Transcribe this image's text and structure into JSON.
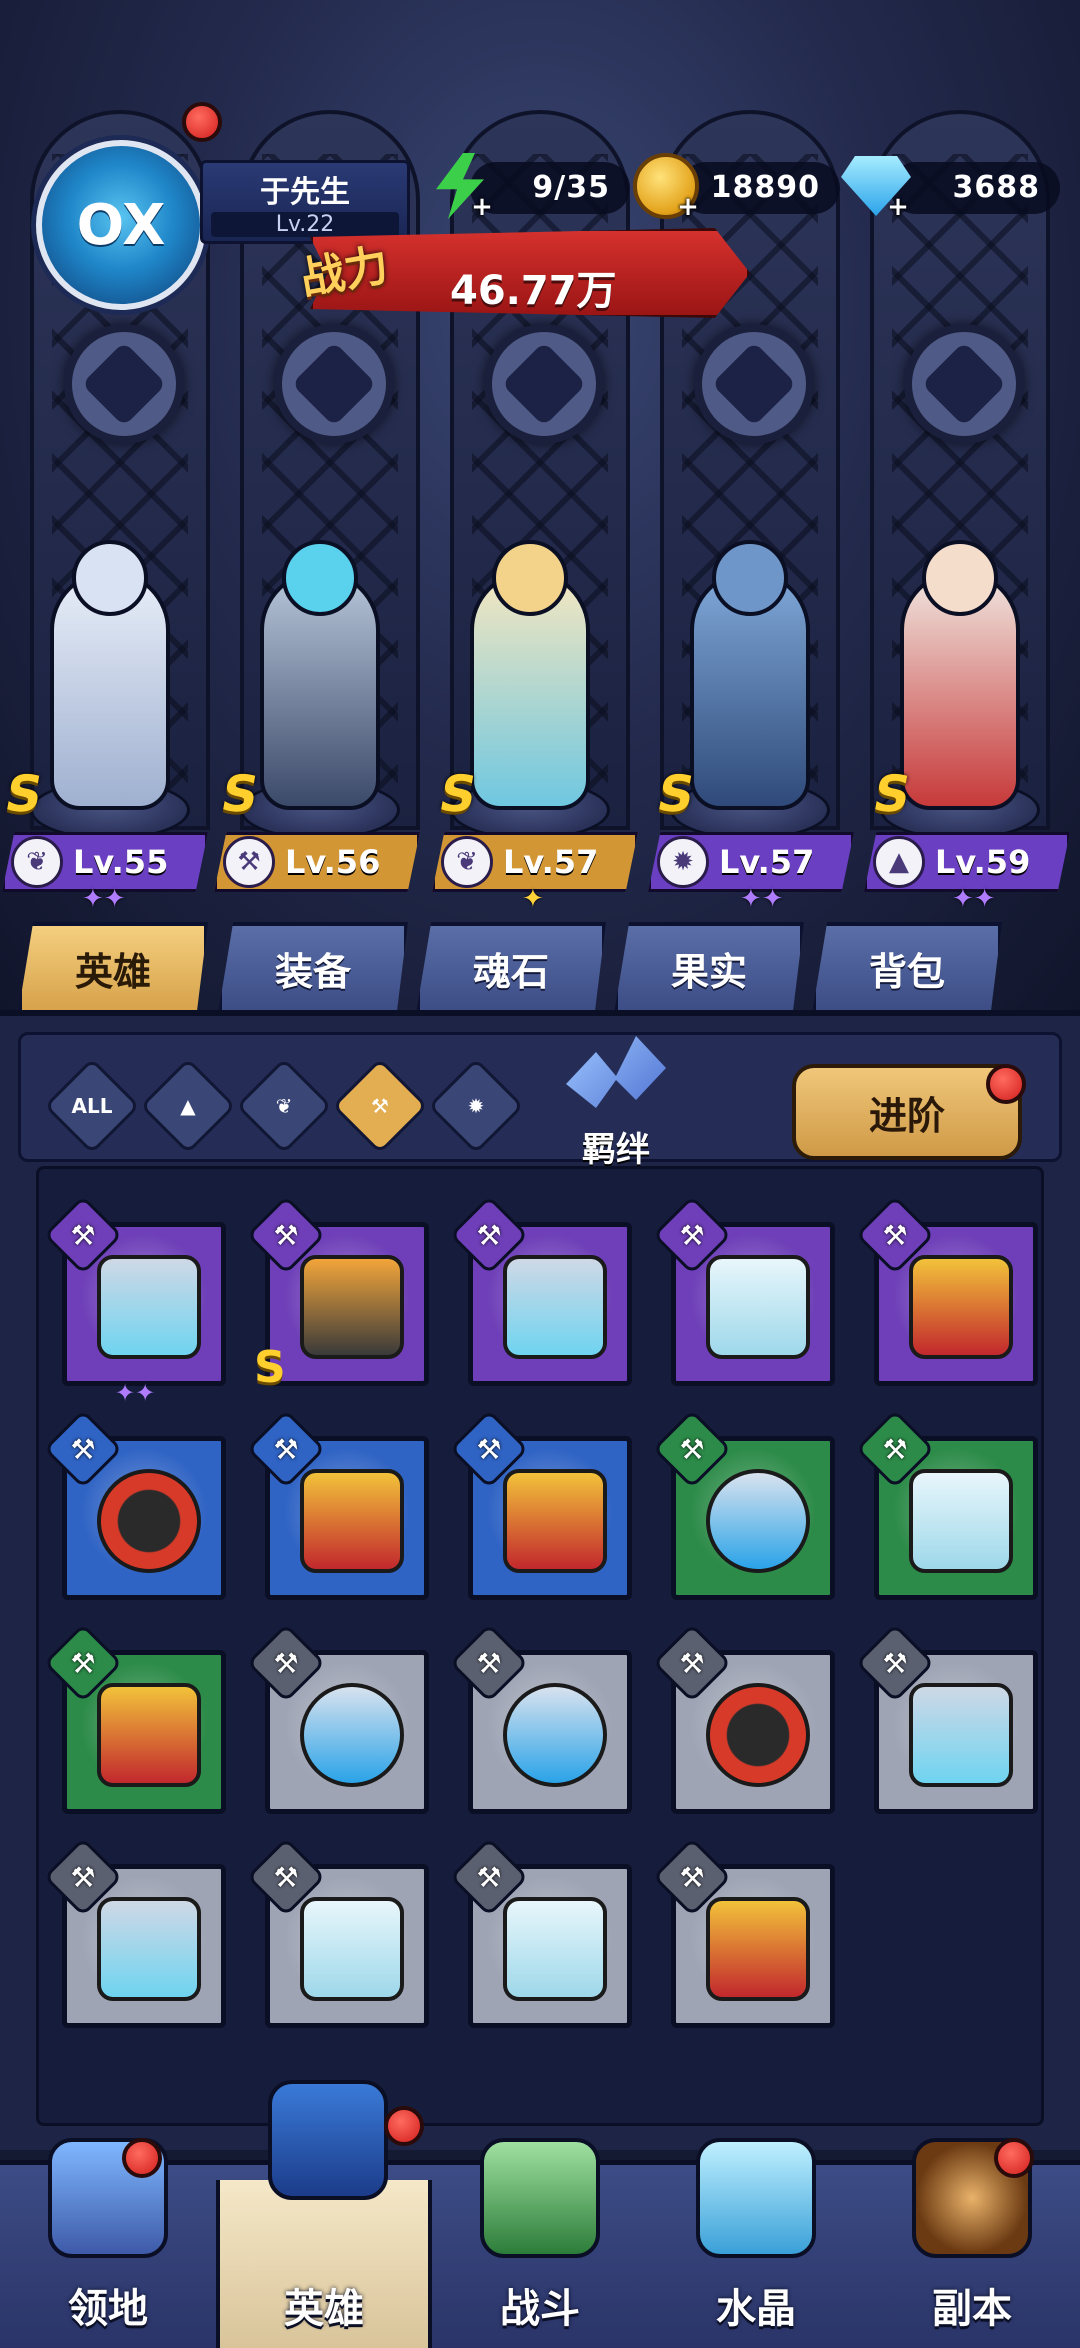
{
  "player": {
    "name": "于先生",
    "level": "Lv.22",
    "avatar_glyph": "OX"
  },
  "resources": {
    "stamina": "9/35",
    "gold": "18890",
    "gems": "3688",
    "plus": "+"
  },
  "power": {
    "label": "战力",
    "value": "46.77万"
  },
  "heroes": [
    {
      "rank": "S",
      "level": "Lv.55",
      "class_icon": "wing-icon",
      "stars": "✦✦",
      "bar_color": "#6a3fc2"
    },
    {
      "rank": "S",
      "level": "Lv.56",
      "class_icon": "wrench-icon",
      "stars": "",
      "bar_color": "#d29634"
    },
    {
      "rank": "S",
      "level": "Lv.57",
      "class_icon": "wing-icon",
      "stars": "✦",
      "bar_color": "#d29634"
    },
    {
      "rank": "S",
      "level": "Lv.57",
      "class_icon": "beast-icon",
      "stars": "✦✦",
      "bar_color": "#6a3fc2"
    },
    {
      "rank": "S",
      "level": "Lv.59",
      "class_icon": "mage-icon",
      "stars": "✦✦",
      "bar_color": "#6a3fc2"
    }
  ],
  "tabs": [
    "英雄",
    "装备",
    "魂石",
    "果实",
    "背包"
  ],
  "filters": {
    "all": "ALL"
  },
  "bond_label": "羁绊",
  "advance_label": "进阶",
  "items": [
    {
      "rarity": "purple",
      "kind": "frame",
      "stars": "✦✦",
      "rank": ""
    },
    {
      "rarity": "purple",
      "kind": "robot",
      "stars": "",
      "rank": "S"
    },
    {
      "rarity": "purple",
      "kind": "frame",
      "stars": "",
      "rank": ""
    },
    {
      "rarity": "purple",
      "kind": "ghost",
      "stars": "",
      "rank": ""
    },
    {
      "rarity": "purple",
      "kind": "core",
      "stars": "",
      "rank": ""
    },
    {
      "rarity": "blue",
      "kind": "bomb",
      "stars": "",
      "rank": ""
    },
    {
      "rarity": "blue",
      "kind": "core",
      "stars": "",
      "rank": ""
    },
    {
      "rarity": "blue",
      "kind": "core",
      "stars": "",
      "rank": ""
    },
    {
      "rarity": "green",
      "kind": "tank",
      "stars": "",
      "rank": ""
    },
    {
      "rarity": "green",
      "kind": "ghost",
      "stars": "",
      "rank": ""
    },
    {
      "rarity": "green",
      "kind": "core",
      "stars": "",
      "rank": ""
    },
    {
      "rarity": "grey",
      "kind": "tank",
      "stars": "",
      "rank": ""
    },
    {
      "rarity": "grey",
      "kind": "tank",
      "stars": "",
      "rank": ""
    },
    {
      "rarity": "grey",
      "kind": "bomb",
      "stars": "",
      "rank": ""
    },
    {
      "rarity": "grey",
      "kind": "frame",
      "stars": "",
      "rank": ""
    },
    {
      "rarity": "grey",
      "kind": "frame",
      "stars": "",
      "rank": ""
    },
    {
      "rarity": "grey",
      "kind": "ghost",
      "stars": "",
      "rank": ""
    },
    {
      "rarity": "grey",
      "kind": "ghost",
      "stars": "",
      "rank": ""
    },
    {
      "rarity": "grey",
      "kind": "core",
      "stars": "",
      "rank": ""
    }
  ],
  "nav": [
    "领地",
    "英雄",
    "战斗",
    "水晶",
    "副本"
  ],
  "colors": {
    "tab_active": "#e3ad51",
    "rarity_purple": "#6e3fb8",
    "rarity_blue": "#2f63c4",
    "rarity_green": "#2c8b48",
    "rarity_grey": "#9ea4b4",
    "notification": "#d21e1e"
  }
}
